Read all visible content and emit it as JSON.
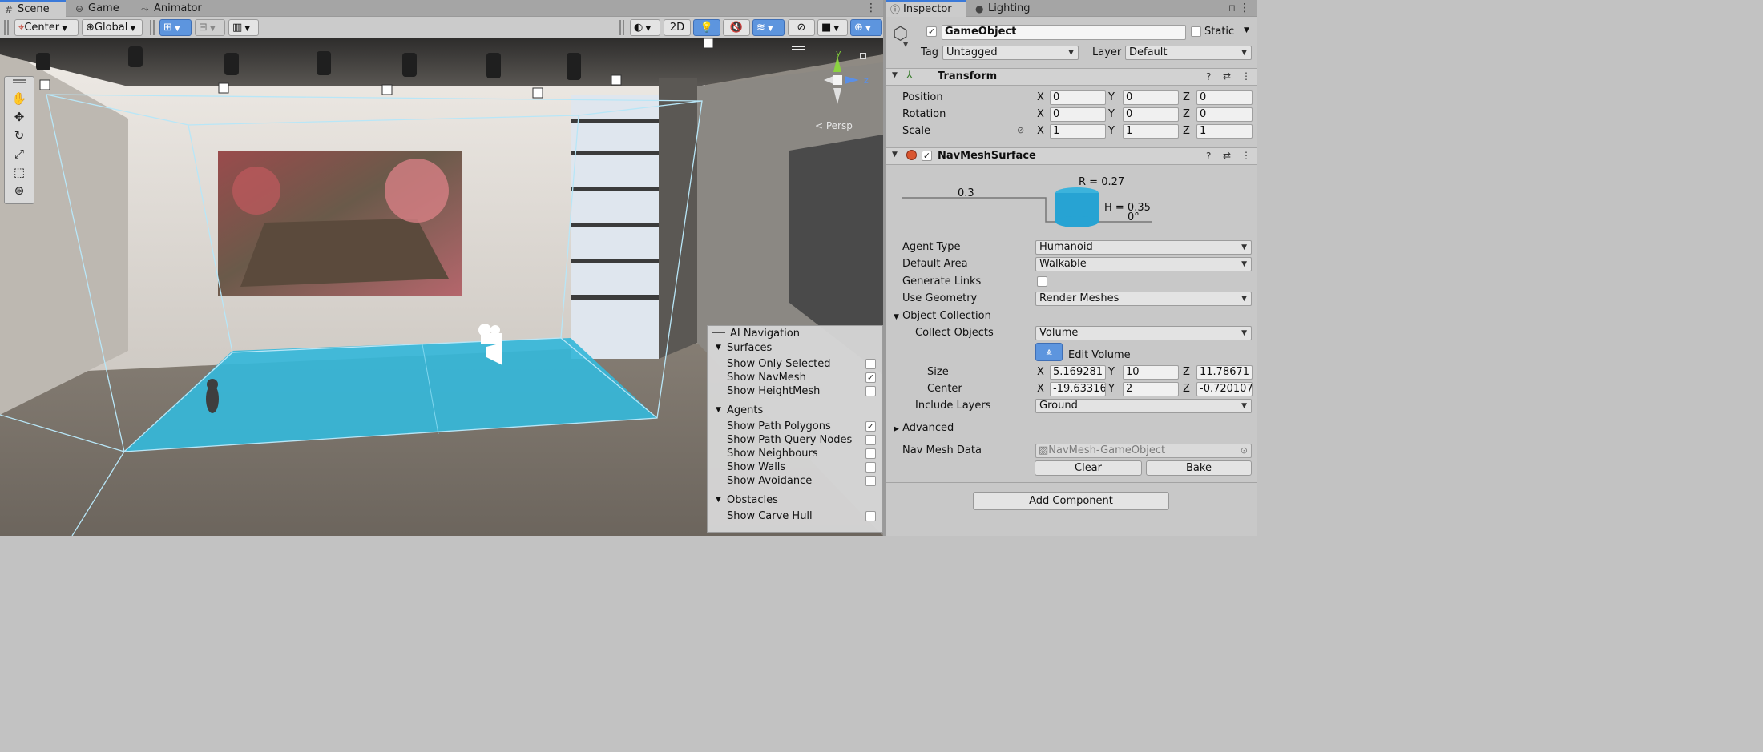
{
  "tabs_left": [
    {
      "label": "Scene",
      "icon": "grid-icon"
    },
    {
      "label": "Game",
      "icon": "gamepad-icon"
    },
    {
      "label": "Animator",
      "icon": "animator-icon"
    }
  ],
  "tabs_right": [
    {
      "label": "Inspector",
      "icon": "info-icon"
    },
    {
      "label": "Lighting",
      "icon": "lightbulb-icon"
    }
  ],
  "toolbar": {
    "pivot": "Center",
    "space": "Global",
    "mode_2d": "2D"
  },
  "scene": {
    "persp_label": "< Persp",
    "gizmo_y": "y",
    "gizmo_z": "z"
  },
  "ainav": {
    "title": "AI Navigation",
    "sections": [
      {
        "label": "Surfaces",
        "items": [
          {
            "label": "Show Only Selected",
            "checked": false
          },
          {
            "label": "Show NavMesh",
            "checked": true
          },
          {
            "label": "Show HeightMesh",
            "checked": false
          }
        ]
      },
      {
        "label": "Agents",
        "items": [
          {
            "label": "Show Path Polygons",
            "checked": true
          },
          {
            "label": "Show Path Query Nodes",
            "checked": false
          },
          {
            "label": "Show Neighbours",
            "checked": false
          },
          {
            "label": "Show Walls",
            "checked": false
          },
          {
            "label": "Show Avoidance",
            "checked": false
          }
        ]
      },
      {
        "label": "Obstacles",
        "items": [
          {
            "label": "Show Carve Hull",
            "checked": false
          }
        ]
      }
    ]
  },
  "inspector": {
    "object_name": "GameObject",
    "static_label": "Static",
    "tag_label": "Tag",
    "tag_value": "Untagged",
    "layer_label": "Layer",
    "layer_value": "Default",
    "transform": {
      "title": "Transform",
      "position": {
        "label": "Position",
        "x": "0",
        "y": "0",
        "z": "0"
      },
      "rotation": {
        "label": "Rotation",
        "x": "0",
        "y": "0",
        "z": "0"
      },
      "scale": {
        "label": "Scale",
        "x": "1",
        "y": "1",
        "z": "1"
      }
    },
    "navmesh": {
      "title": "NavMeshSurface",
      "diagram": {
        "step": "0.3",
        "radius": "R = 0.27",
        "height": "H = 0.35",
        "angle": "0°"
      },
      "agent_type": {
        "label": "Agent Type",
        "value": "Humanoid"
      },
      "default_area": {
        "label": "Default Area",
        "value": "Walkable"
      },
      "generate_links": {
        "label": "Generate Links"
      },
      "use_geometry": {
        "label": "Use Geometry",
        "value": "Render Meshes"
      },
      "object_collection": "Object Collection",
      "collect_objects": {
        "label": "Collect Objects",
        "value": "Volume"
      },
      "edit_volume": "Edit Volume",
      "size": {
        "label": "Size",
        "x": "5.169281",
        "y": "10",
        "z": "11.78671"
      },
      "center": {
        "label": "Center",
        "x": "-19.63316",
        "y": "2",
        "z": "-0.720107"
      },
      "include_layers": {
        "label": "Include Layers",
        "value": "Ground"
      },
      "advanced": "Advanced",
      "nav_mesh_data": {
        "label": "Nav Mesh Data",
        "value": "NavMesh-GameObject"
      },
      "clear": "Clear",
      "bake": "Bake"
    },
    "add_component": "Add Component",
    "axis": {
      "x": "X",
      "y": "Y",
      "z": "Z"
    }
  }
}
